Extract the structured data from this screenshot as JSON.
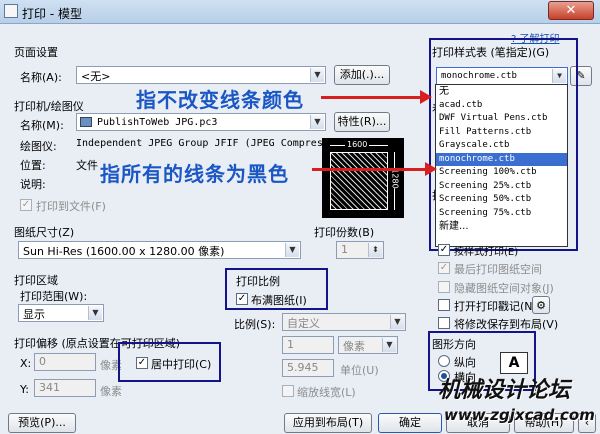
{
  "window": {
    "title": "打印 - 模型",
    "close": "✕"
  },
  "page_setup": {
    "section": "页面设置",
    "name_label": "名称(A):",
    "name_value": "<无>",
    "add_button": "添加(.)..."
  },
  "printer": {
    "section": "打印机/绘图仪",
    "name_label": "名称(M):",
    "name_value": "PublishToWeb JPG.pc3",
    "properties_button": "特性(R)...",
    "plotter_label": "绘图仪:",
    "plotter_value": "Independent JPEG Group JFIF (JPEG Compressi...",
    "location_label": "位置:",
    "location_value": "文件",
    "description_label": "说明:",
    "print_to_file": "打印到文件(F)"
  },
  "preview": {
    "width_label": "1600",
    "height_label": "1280"
  },
  "paper_size": {
    "section": "图纸尺寸(Z)",
    "value": "Sun Hi-Res (1600.00 x 1280.00 像素)"
  },
  "copies": {
    "section": "打印份数(B)",
    "value": "1"
  },
  "plot_area": {
    "section": "打印区域",
    "range_label": "打印范围(W):",
    "range_value": "显示"
  },
  "plot_offset": {
    "section": "打印偏移 (原点设置在可打印区域)",
    "x_label": "X:",
    "x_value": "0",
    "y_label": "Y:",
    "y_value": "341",
    "unit": "像素",
    "center_label": "居中打印(C)"
  },
  "plot_scale": {
    "section": "打印比例",
    "fit_label": "布满图纸(I)",
    "scale_label": "比例(S):",
    "scale_value": "自定义",
    "val1": "1",
    "unit1": "像素",
    "val2": "5.945",
    "unit2": "单位(U)",
    "lineweight_label": "缩放线宽(L)"
  },
  "plot_style": {
    "section": "打印样式表 (笔指定)(G)",
    "selected": "monochrome.ctb",
    "help_link": "了解打印",
    "items": [
      "无",
      "acad.ctb",
      "DWF Virtual Pens.ctb",
      "Fill Patterns.ctb",
      "Grayscale.ctb",
      "monochrome.ctb",
      "Screening 100%.ctb",
      "Screening 25%.ctb",
      "Screening 50%.ctb",
      "Screening 75%.ctb",
      "新建..."
    ],
    "selected_index": 5,
    "behind_letter_1": "着",
    "behind_letter_2": "打",
    "behind_option": "按样式打印(E)"
  },
  "options": {
    "last_plot": "最后打印图纸空间",
    "hide_objects": "隐藏图纸空间对象(J)",
    "stamp": "打开打印戳记(N)",
    "save_layout": "将修改保存到布局(V)"
  },
  "orientation": {
    "section": "图形方向",
    "portrait": "纵向",
    "landscape": "横向"
  },
  "footer": {
    "preview_button": "预览(P)...",
    "apply_button": "应用到布局(T)",
    "ok_button": "确定",
    "cancel_button": "取消",
    "help_button": "帮助(H)"
  },
  "annotations": {
    "top": "指不改变线条颜色",
    "middle": "指所有的线条为黑色"
  },
  "watermark": {
    "name": "机械设计论坛",
    "url": "www.zgjxcad.com"
  },
  "colors": {
    "annotation_blue": "#1b57c4",
    "arrow_red": "#d81e1e",
    "box_navy": "#14148a",
    "selection": "#3a6fd1"
  }
}
